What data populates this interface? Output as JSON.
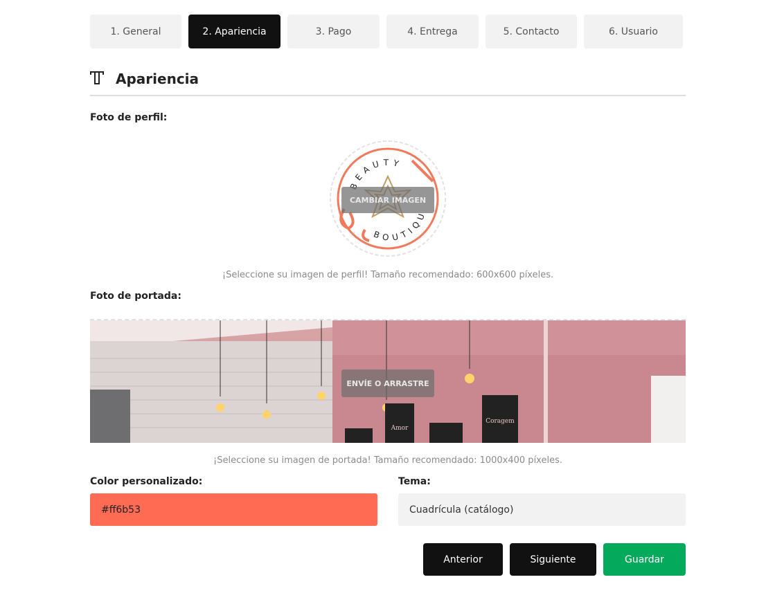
{
  "steps": [
    {
      "label": "1. General",
      "active": false
    },
    {
      "label": "2. Apariencia",
      "active": true
    },
    {
      "label": "3. Pago",
      "active": false
    },
    {
      "label": "4. Entrega",
      "active": false
    },
    {
      "label": "5. Contacto",
      "active": false
    },
    {
      "label": "6. Usuario",
      "active": false
    }
  ],
  "section": {
    "title": "Apariencia",
    "icon": "text-t-icon"
  },
  "profile": {
    "label": "Foto de perfil:",
    "change_label": "CAMBIAR IMAGEN",
    "logo_text_top": "BEAUTY",
    "logo_text_bottom": "BOUTIQUE",
    "hint": "¡Seleccione su imagen de perfil! Tamaño recomendado: 600x600 píxeles."
  },
  "cover": {
    "label": "Foto de portada:",
    "upload_label": "ENVÍE O ARRASTRE",
    "sign_1": "Amor",
    "sign_2": "Coragem",
    "hint": "¡Seleccione su imagen de portada! Tamaño recomendado: 1000x400 píxeles."
  },
  "color": {
    "label": "Color personalizado:",
    "value": "#ff6b53"
  },
  "theme": {
    "label": "Tema:",
    "value": "Cuadrícula (catálogo)"
  },
  "buttons": {
    "prev": "Anterior",
    "next": "Siguiente",
    "save": "Guardar"
  },
  "colors": {
    "accent": "#ff6b53",
    "dark": "#111111",
    "save": "#05a95c",
    "muted_bg": "#f2f2f2"
  }
}
